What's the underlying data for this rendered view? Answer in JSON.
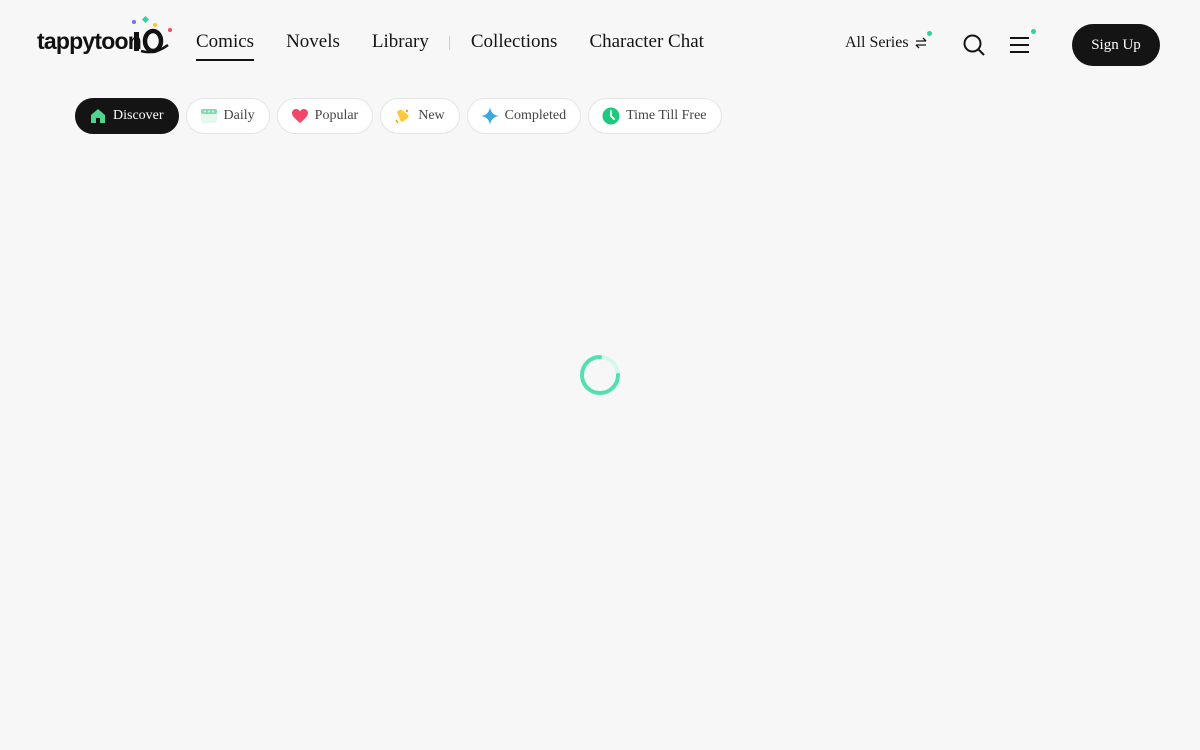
{
  "header": {
    "logo": {
      "word": "tappytoon",
      "number": "10"
    },
    "nav": [
      {
        "label": "Comics",
        "active": true
      },
      {
        "label": "Novels",
        "active": false
      },
      {
        "label": "Library",
        "active": false
      },
      {
        "label": "Collections",
        "active": false
      },
      {
        "label": "Character Chat",
        "active": false
      }
    ],
    "all_series": {
      "label": "All Series",
      "icon": "swap-arrows-icon"
    },
    "search_icon": "search-icon",
    "menu_icon": "hamburger-menu-icon",
    "sign_up_label": "Sign Up"
  },
  "tabs": [
    {
      "label": "Discover",
      "icon": "house-icon",
      "active": true
    },
    {
      "label": "Daily",
      "icon": "calendar-icon",
      "active": false
    },
    {
      "label": "Popular",
      "icon": "heart-icon",
      "active": false
    },
    {
      "label": "New",
      "icon": "bell-icon",
      "active": false
    },
    {
      "label": "Completed",
      "icon": "sparkle-icon",
      "active": false
    },
    {
      "label": "Time Till Free",
      "icon": "clock-icon",
      "active": false
    }
  ],
  "loading": {
    "icon": "loading-spinner-icon"
  },
  "colors": {
    "accent": "#2fd49c",
    "dark": "#141414",
    "background": "#f7f7f7"
  }
}
